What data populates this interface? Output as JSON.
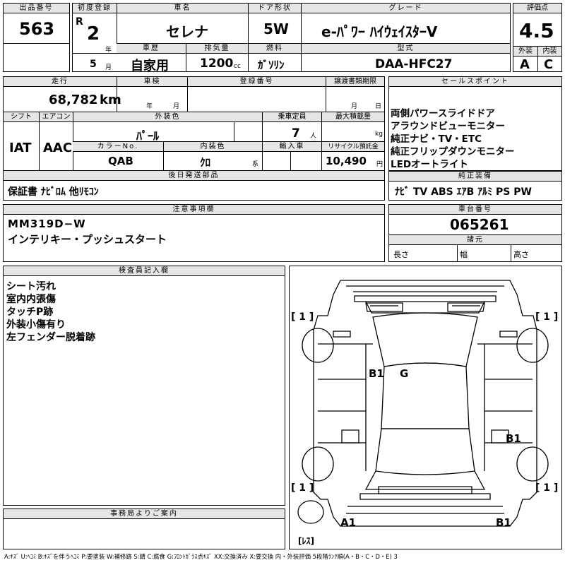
{
  "top": {
    "lot_label": "出品番号",
    "lot_value": "563",
    "reg_label": "初度登録",
    "era": "R",
    "year_value": "2",
    "year_unit": "年",
    "month_value": "5",
    "month_unit": "月",
    "name_label": "車名",
    "name_value": "セレナ",
    "door_label": "ドア形状",
    "door_value": "5W",
    "grade_label": "グレード",
    "grade_value": "e-ﾊﾟﾜｰ ﾊｲｳｪｲｽﾀｰV",
    "score_label": "評価点",
    "score_value": "4.5",
    "ext_label": "外装",
    "int_label": "内装",
    "ext_value": "A",
    "int_value": "C",
    "history_label": "車歴",
    "history_value": "自家用",
    "displacement_label": "排気量",
    "displacement_value": "1200",
    "displacement_unit": "cc",
    "fuel_label": "燃料",
    "fuel_value": "ｶﾞｿﾘﾝ",
    "model_label": "型式",
    "model_value": "DAA-HFC27"
  },
  "row2": {
    "mileage_label": "走行",
    "mileage_value": "68,782",
    "mileage_unit": "km",
    "inspection_label": "車検",
    "inspection_year": "年",
    "inspection_month": "月",
    "plate_label": "登録番号",
    "transfer_label": "譲渡書類期限",
    "transfer_month": "月",
    "transfer_day": "日",
    "sales_label": "セールスポイント",
    "sales_points": [
      "両側パワースライドドア",
      "アラウンドビューモニター",
      "純正ナビ・TV・ETC",
      "純正フリップダウンモニター",
      "LEDオートライト"
    ]
  },
  "row3": {
    "shift_label": "シフト",
    "shift_value": "IAT",
    "ac_label": "エアコン",
    "ac_value": "AAC",
    "exterior_color_label": "外装色",
    "exterior_color_value": "ﾊﾟｰﾙ",
    "capacity_label": "乗車定員",
    "capacity_value": "7",
    "capacity_unit": "人",
    "load_label": "最大積載量",
    "load_unit": "kg",
    "color_no_label": "カラーNo.",
    "color_no_value": "QAB",
    "interior_color_label": "内装色",
    "interior_color_value": "ｸﾛ",
    "interior_unit": "系",
    "import_label": "輸入車",
    "recycle_label": "リサイクル預託金",
    "recycle_value": "10,490",
    "recycle_unit": "円"
  },
  "later": {
    "label": "後日発送部品",
    "value": "保証書 ﾅﾋﾞﾛﾑ 他ﾘﾓｺﾝ"
  },
  "equipment": {
    "label": "純正装備",
    "value": "ﾅﾋﾞ TV ABS ｴｱB ｱﾙﾐ PS PW"
  },
  "notes": {
    "label": "注意事項欄",
    "lines": [
      "MM319D−W",
      "インテリキー・プッシュスタート"
    ]
  },
  "chassis": {
    "label": "車台番号",
    "value": "065261",
    "spec_label": "諸元",
    "length": "長さ",
    "width": "幅",
    "height": "高さ"
  },
  "inspector": {
    "label": "検査員記入欄",
    "lines": [
      "シート汚れ",
      "室内内張傷",
      "タッチP跡",
      "外装小傷有り",
      "左フェンダー脱着跡"
    ]
  },
  "office": {
    "label": "事務局よりご案内"
  },
  "diagram": {
    "marks": {
      "b1_a": "B1",
      "g": "G",
      "b1_b": "B1",
      "a1": "A1",
      "b1_c": "B1"
    },
    "tires": {
      "fl": "[ 1 ]",
      "fr": "[ 1 ]",
      "rl": "[ 1 ]",
      "rr": "[ 1 ]",
      "spare": "[ﾚｽ]"
    }
  },
  "legend": "A:ｷｽﾞ U:ﾍｺﾐ B:ｷｽﾞを伴うﾍｺﾐ P:要塗装 W:補修跡 S:錆 C:腐食 G:ﾌﾛﾝﾄｶﾞﾗｽ点ｷｽﾞ XX:交換済み X:要交換 内・外装評価 5段階ﾗﾝｸ順(A・B・C・D・E) 3"
}
